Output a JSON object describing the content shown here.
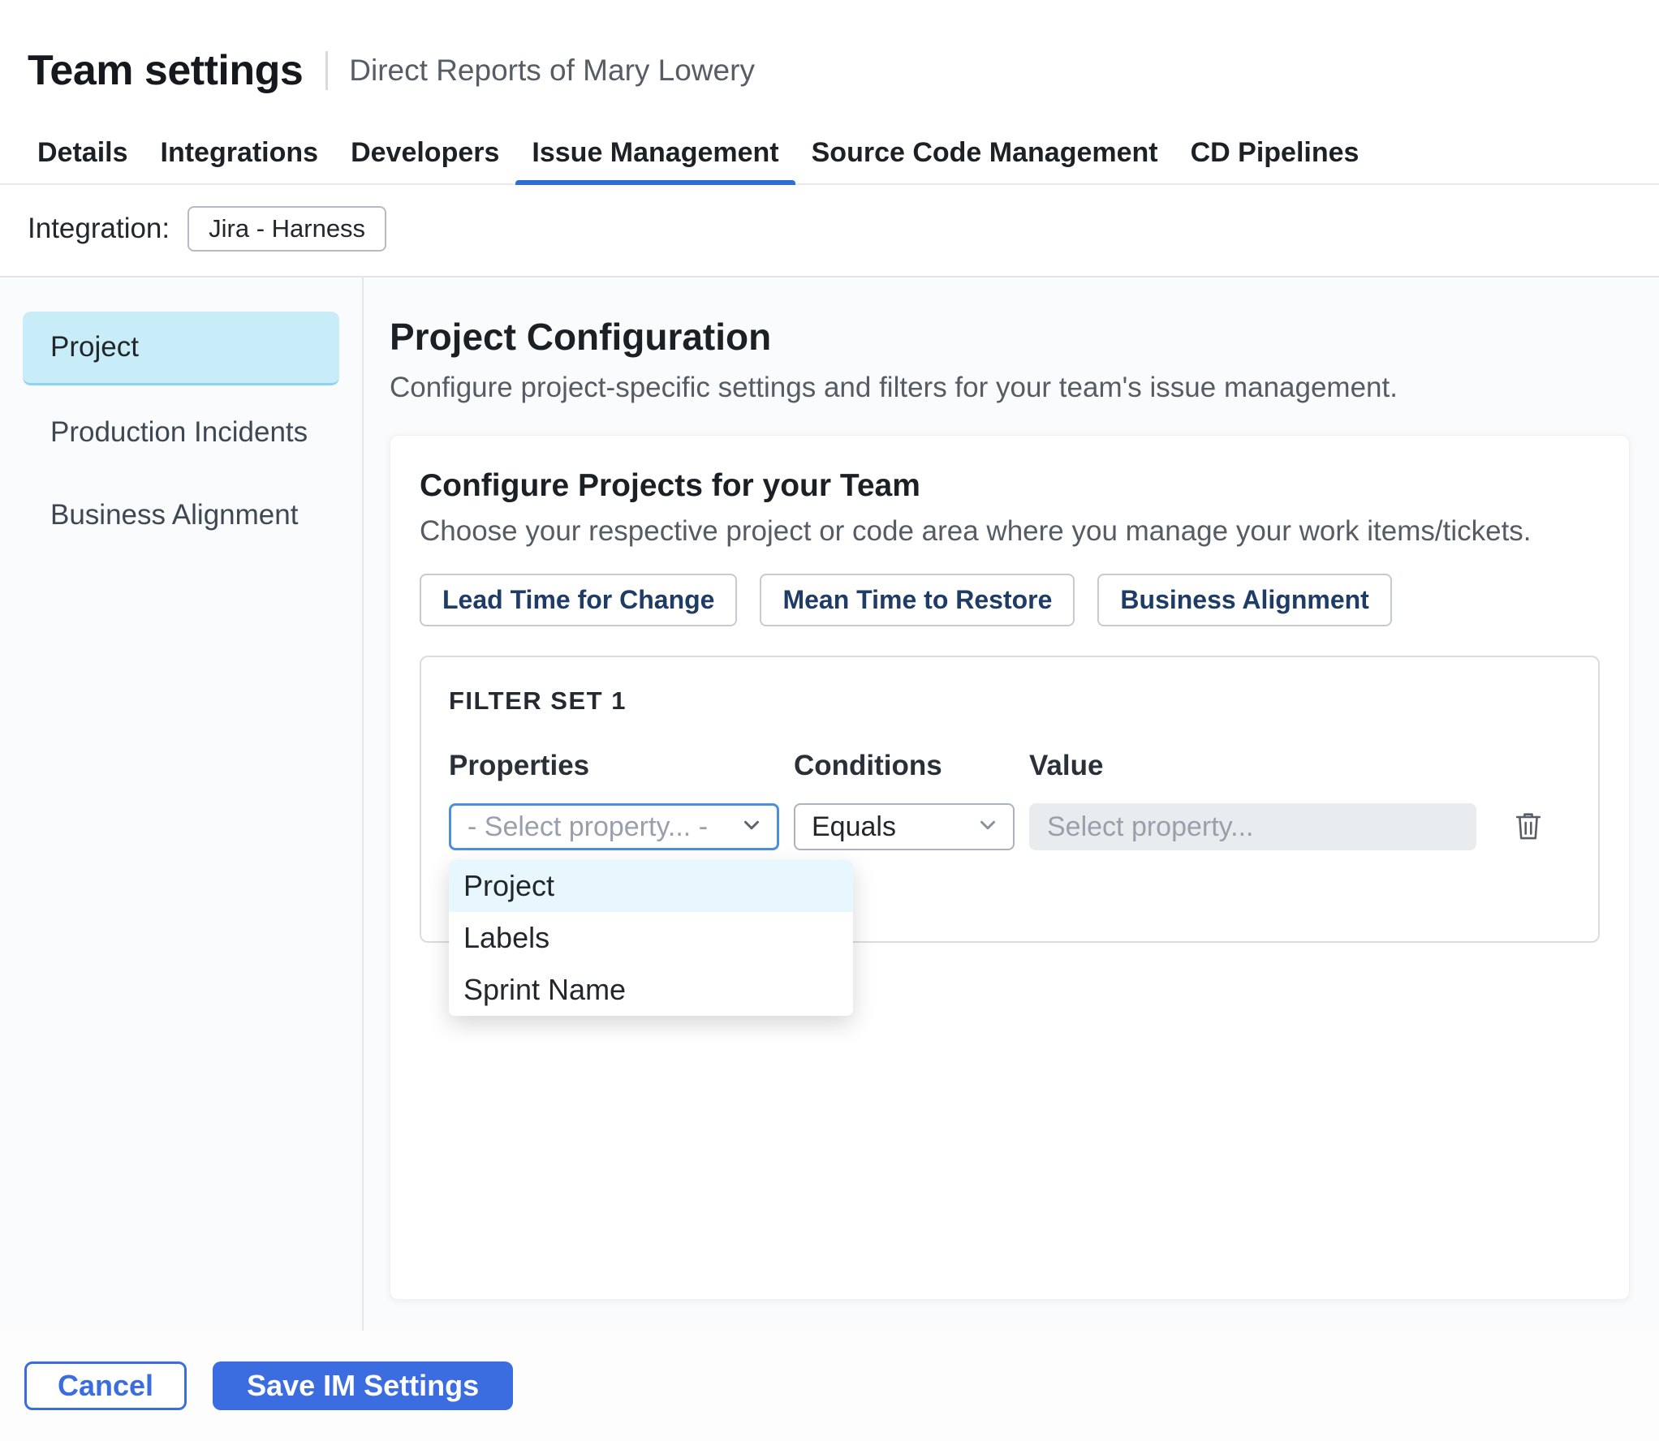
{
  "header": {
    "title": "Team settings",
    "subtitle": "Direct Reports of Mary Lowery"
  },
  "tabs": [
    "Details",
    "Integrations",
    "Developers",
    "Issue Management",
    "Source Code Management",
    "CD Pipelines"
  ],
  "active_tab": "Issue Management",
  "integration": {
    "label": "Integration:",
    "value": "Jira - Harness"
  },
  "sidebar": {
    "items": [
      "Project",
      "Production Incidents",
      "Business Alignment"
    ],
    "active": "Project"
  },
  "main": {
    "title": "Project Configuration",
    "subtitle": "Configure project-specific settings and filters for your team's issue management.",
    "card": {
      "title": "Configure Projects for your Team",
      "subtitle": "Choose your respective project or code area where you manage your work items/tickets.",
      "chips": [
        "Lead Time for Change",
        "Mean Time to Restore",
        "Business Alignment"
      ],
      "filter_set": {
        "title": "FILTER SET 1",
        "columns": [
          "Properties",
          "Conditions",
          "Value"
        ],
        "property_placeholder": "- Select property... -",
        "condition_value": "Equals",
        "value_placeholder": "Select property...",
        "dropdown_options": [
          "Project",
          "Labels",
          "Sprint Name"
        ],
        "dropdown_highlighted": "Project"
      }
    }
  },
  "footer": {
    "cancel_label": "Cancel",
    "save_label": "Save IM Settings"
  },
  "colors": {
    "accent": "#3b6ce0",
    "tab_underline": "#2e6fd6",
    "sidebar_active_bg": "#c9edf8",
    "dropdown_highlight": "#e7f7fd",
    "disabled_input_bg": "#e9ecef"
  }
}
